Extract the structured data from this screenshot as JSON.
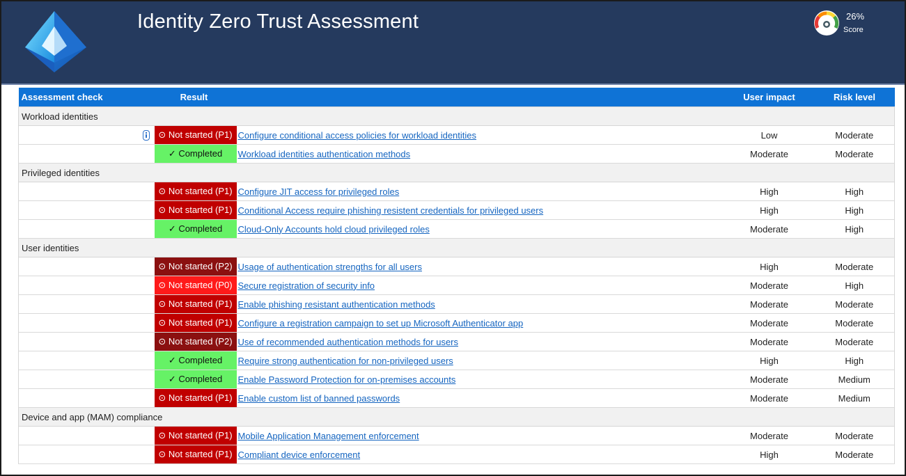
{
  "header": {
    "title": "Identity Zero Trust Assessment",
    "score_pct": "26%",
    "score_label": "Score",
    "logo_icon": "azure-entra-id-pyramid-icon",
    "gauge_icon": "score-gauge-icon"
  },
  "columns": {
    "check": "Assessment check",
    "result": "Result",
    "impact": "User impact",
    "risk": "Risk level"
  },
  "colors": {
    "header_bg": "#253a5e",
    "table_header_bg": "#0f73d6",
    "status_p0": "#ff1a1a",
    "status_p1": "#c00000",
    "status_p2": "#8b1010",
    "status_completed": "#66f266",
    "link": "#1565c0"
  },
  "groups": [
    {
      "name": "Workload identities",
      "rows": [
        {
          "status": "p1",
          "result": "⊙ Not started (P1)",
          "check": "Configure conditional access policies for workload identities",
          "impact": "Low",
          "risk": "Moderate",
          "info": true
        },
        {
          "status": "completed",
          "result": "✓ Completed",
          "check": "Workload identities authentication methods",
          "impact": "Moderate",
          "risk": "Moderate"
        }
      ]
    },
    {
      "name": "Privileged identities",
      "rows": [
        {
          "status": "p1",
          "result": "⊙ Not started (P1)",
          "check": "Configure JIT access for privileged roles",
          "impact": "High",
          "risk": "High"
        },
        {
          "status": "p1",
          "result": "⊙ Not started (P1)",
          "check": "Conditional Access require phishing resistent credentials for privileged users",
          "impact": "High",
          "risk": "High"
        },
        {
          "status": "completed",
          "result": "✓ Completed",
          "check": "Cloud-Only Accounts hold cloud privileged roles",
          "impact": "Moderate",
          "risk": "High"
        }
      ]
    },
    {
      "name": "User identities",
      "rows": [
        {
          "status": "p2",
          "result": "⊙ Not started (P2)",
          "check": "Usage of authentication strengths for all users",
          "impact": "High",
          "risk": "Moderate"
        },
        {
          "status": "p0",
          "result": "⊙ Not started (P0)",
          "check": "Secure registration of security info",
          "impact": "Moderate",
          "risk": "High"
        },
        {
          "status": "p1",
          "result": "⊙ Not started (P1)",
          "check": "Enable phishing resistant authentication methods",
          "impact": "Moderate",
          "risk": "Moderate"
        },
        {
          "status": "p1",
          "result": "⊙ Not started (P1)",
          "check": "Configure a registration campaign to set up Microsoft Authenticator app",
          "impact": "Moderate",
          "risk": "Moderate"
        },
        {
          "status": "p2",
          "result": "⊙ Not started (P2)",
          "check": "Use of recommended authentication methods for users",
          "impact": "Moderate",
          "risk": "Moderate"
        },
        {
          "status": "completed",
          "result": "✓ Completed",
          "check": "Require strong authentication for non-privileged users",
          "impact": "High",
          "risk": "High"
        },
        {
          "status": "completed",
          "result": "✓ Completed",
          "check": "Enable Password Protection for on-premises accounts",
          "impact": "Moderate",
          "risk": "Medium"
        },
        {
          "status": "p1",
          "result": "⊙ Not started (P1)",
          "check": "Enable custom list of banned passwords",
          "impact": "Moderate",
          "risk": "Medium"
        }
      ]
    },
    {
      "name": "Device and app (MAM) compliance",
      "rows": [
        {
          "status": "p1",
          "result": "⊙ Not started (P1)",
          "check": "Mobile Application Management enforcement",
          "impact": "Moderate",
          "risk": "Moderate"
        },
        {
          "status": "p1",
          "result": "⊙ Not started (P1)",
          "check": "Compliant device enforcement",
          "impact": "High",
          "risk": "Moderate"
        }
      ]
    }
  ]
}
